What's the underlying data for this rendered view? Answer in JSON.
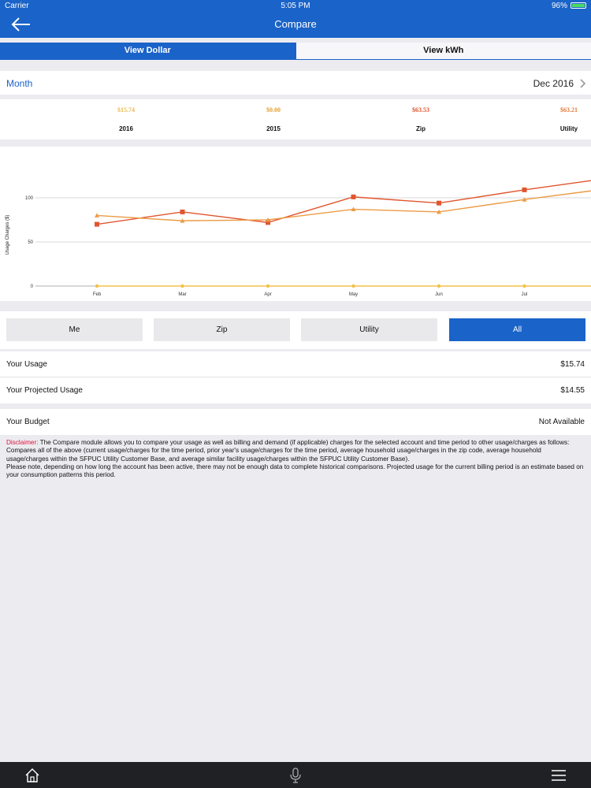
{
  "status_bar": {
    "carrier": "Carrier",
    "time": "5:05 PM",
    "battery": "96%"
  },
  "nav": {
    "title": "Compare",
    "back_icon": "back-arrow-icon"
  },
  "view_toggle": {
    "dollar": "View Dollar",
    "kwh": "View kWh",
    "selected": "dollar"
  },
  "period": {
    "label": "Month",
    "value": "Dec 2016",
    "icon": "chevron-right-icon"
  },
  "summary": [
    {
      "amount": "$15.74",
      "label": "2016",
      "color": "#f0b84a"
    },
    {
      "amount": "$0.00",
      "label": "2015",
      "color": "#e5a032"
    },
    {
      "amount": "$63.53",
      "label": "Zip",
      "color": "#d9542c"
    },
    {
      "amount": "$63.21",
      "label": "Utility",
      "color": "#e07a3a"
    }
  ],
  "chart_data": {
    "type": "line",
    "ylabel": "Usage Charges ($)",
    "xlabel": "",
    "categories": [
      "Feb",
      "Mar",
      "Apr",
      "May",
      "Jun",
      "Jul"
    ],
    "y_ticks": [
      "0",
      "50",
      "100"
    ],
    "ylim": [
      0,
      100
    ],
    "grid": true,
    "series": [
      {
        "values": [
          70,
          84,
          72,
          101,
          94,
          109
        ],
        "color": "#e0562f",
        "marker": "square"
      },
      {
        "values": [
          80,
          74,
          75,
          87,
          84,
          98
        ],
        "color": "#eb9b45",
        "marker": "triangle"
      },
      {
        "values": [
          0,
          0,
          0,
          0,
          0,
          0
        ],
        "color": "#f3c14b",
        "marker": "circle"
      }
    ]
  },
  "filters": {
    "items": [
      "Me",
      "Zip",
      "Utility",
      "All"
    ],
    "selected": "All"
  },
  "usage": {
    "your_usage_label": "Your Usage",
    "your_usage_value": "$15.74",
    "projected_label": "Your Projected Usage",
    "projected_value": "$14.55"
  },
  "budget": {
    "label": "Your Budget",
    "value": "Not Available"
  },
  "disclaimer": {
    "label": "Disclaimer:",
    "p1": " The Compare module allows you to compare your usage as well as billing and demand (if applicable) charges for the selected account and time period to other usage/charges as follows:",
    "p2": "Compares all of the above (current usage/charges for the time period, prior year's usage/charges for the time period, average household usage/charges in the zip code, average household usage/charges within the SFPUC Utility Customer Base, and average similar facility usage/charges within the SFPUC Utility Customer Base).",
    "p3": "Please note, depending on how long the account has been active, there may not be enough data to complete historical comparisons. Projected usage for the current billing period is an estimate based on your consumption patterns this period."
  },
  "tab_bar": {
    "home_icon": "home-icon",
    "mic_icon": "microphone-icon",
    "menu_icon": "hamburger-menu-icon"
  },
  "colors": {
    "primary": "#1a63c8",
    "background": "#ececf0"
  }
}
